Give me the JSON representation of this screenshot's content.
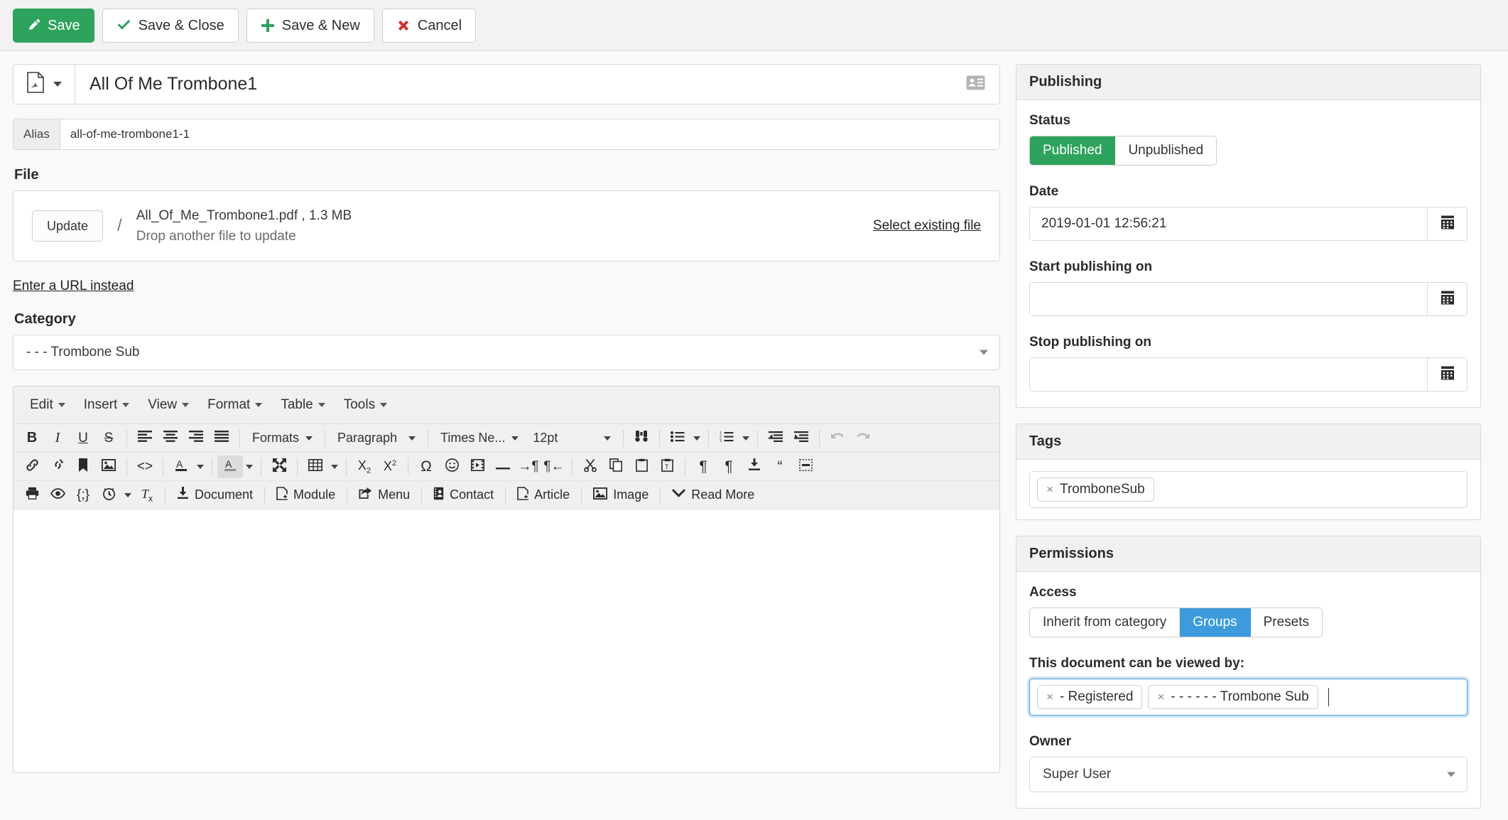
{
  "toolbar": {
    "save": "Save",
    "save_close": "Save & Close",
    "save_new": "Save & New",
    "cancel": "Cancel"
  },
  "document": {
    "title": "All Of Me Trombone1",
    "type_icon": "pdf-file-icon",
    "alias_label": "Alias",
    "alias_value": "all-of-me-trombone1-1",
    "contact_icon": "contact-card-icon"
  },
  "file": {
    "label": "File",
    "update_button": "Update",
    "separator": "/",
    "name_and_size": "All_Of_Me_Trombone1.pdf , 1.3 MB",
    "drop_hint": "Drop another file to update",
    "select_existing": "Select existing file",
    "url_instead": "Enter a URL instead"
  },
  "category": {
    "label": "Category",
    "value": "- - - Trombone Sub"
  },
  "editor": {
    "menus": [
      "Edit",
      "Insert",
      "View",
      "Format",
      "Table",
      "Tools"
    ],
    "row1": {
      "bold": "B",
      "italic": "I",
      "underline": "U",
      "strikethrough": "S",
      "formats": "Formats",
      "paragraph": "Paragraph",
      "fontname": "Times Ne...",
      "fontsize": "12pt"
    },
    "row3": {
      "document": "Document",
      "module": "Module",
      "menu": "Menu",
      "contact": "Contact",
      "article": "Article",
      "image": "Image",
      "readmore": "Read More"
    },
    "content": ""
  },
  "publishing": {
    "title": "Publishing",
    "status_label": "Status",
    "status_options": [
      "Published",
      "Unpublished"
    ],
    "status_selected": "Published",
    "date_label": "Date",
    "date_value": "2019-01-01 12:56:21",
    "start_label": "Start publishing on",
    "start_value": "",
    "stop_label": "Stop publishing on",
    "stop_value": ""
  },
  "tags": {
    "title": "Tags",
    "items": [
      "TromboneSub"
    ]
  },
  "permissions": {
    "title": "Permissions",
    "access_label": "Access",
    "access_options": [
      "Inherit from category",
      "Groups",
      "Presets"
    ],
    "access_selected": "Groups",
    "viewers_label": "This document can be viewed by:",
    "viewers": [
      "- Registered",
      "- - - - - - Trombone Sub"
    ],
    "owner_label": "Owner",
    "owner_value": "Super User"
  },
  "colors": {
    "green": "#2ea35d",
    "blue": "#3d9bdd",
    "red": "#cc3333",
    "panel_header": "#f1f1f1"
  }
}
